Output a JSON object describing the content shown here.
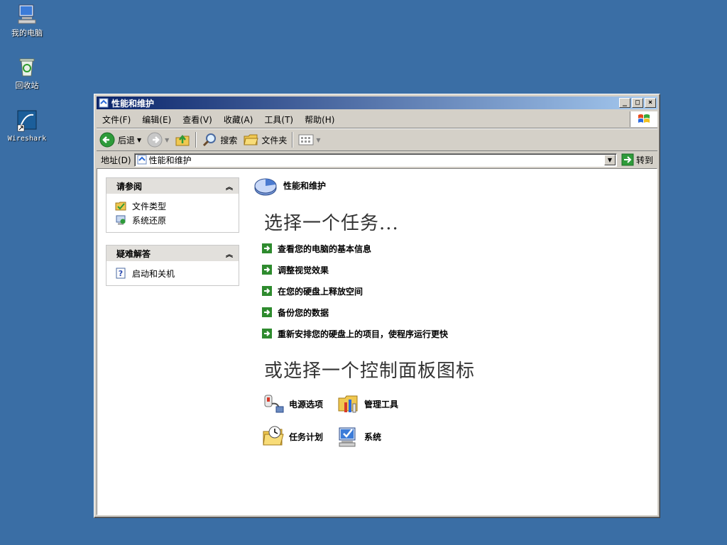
{
  "desktop": {
    "icons": [
      {
        "label": "我的电脑"
      },
      {
        "label": "回收站"
      },
      {
        "label": "Wireshark"
      }
    ]
  },
  "window": {
    "title": "性能和维护",
    "controls": {
      "minimize": "_",
      "maximize": "□",
      "close": "×"
    },
    "menu": [
      "文件(F)",
      "编辑(E)",
      "查看(V)",
      "收藏(A)",
      "工具(T)",
      "帮助(H)"
    ],
    "toolbar": {
      "back": "后退",
      "search": "搜索",
      "folders": "文件夹"
    },
    "address": {
      "label": "地址(D)",
      "value": "性能和维护",
      "go": "转到"
    }
  },
  "sidebar": {
    "see_also": {
      "title": "请参阅",
      "items": [
        "文件类型",
        "系统还原"
      ]
    },
    "troubleshoot": {
      "title": "疑难解答",
      "items": [
        "启动和关机"
      ]
    }
  },
  "main": {
    "header": "性能和维护",
    "task_title": "选择一个任务...",
    "tasks": [
      "查看您的电脑的基本信息",
      "调整视觉效果",
      "在您的硬盘上释放空间",
      "备份您的数据",
      "重新安排您的硬盘上的项目，使程序运行更快"
    ],
    "cp_title": "或选择一个控制面板图标",
    "cp_icons": [
      "电源选项",
      "管理工具",
      "任务计划",
      "系统"
    ]
  },
  "colors": {
    "desktop": "#3a6ea5",
    "title_start": "#0a246a",
    "title_end": "#a6caf0",
    "task_arrow": "#2e8b2e"
  }
}
